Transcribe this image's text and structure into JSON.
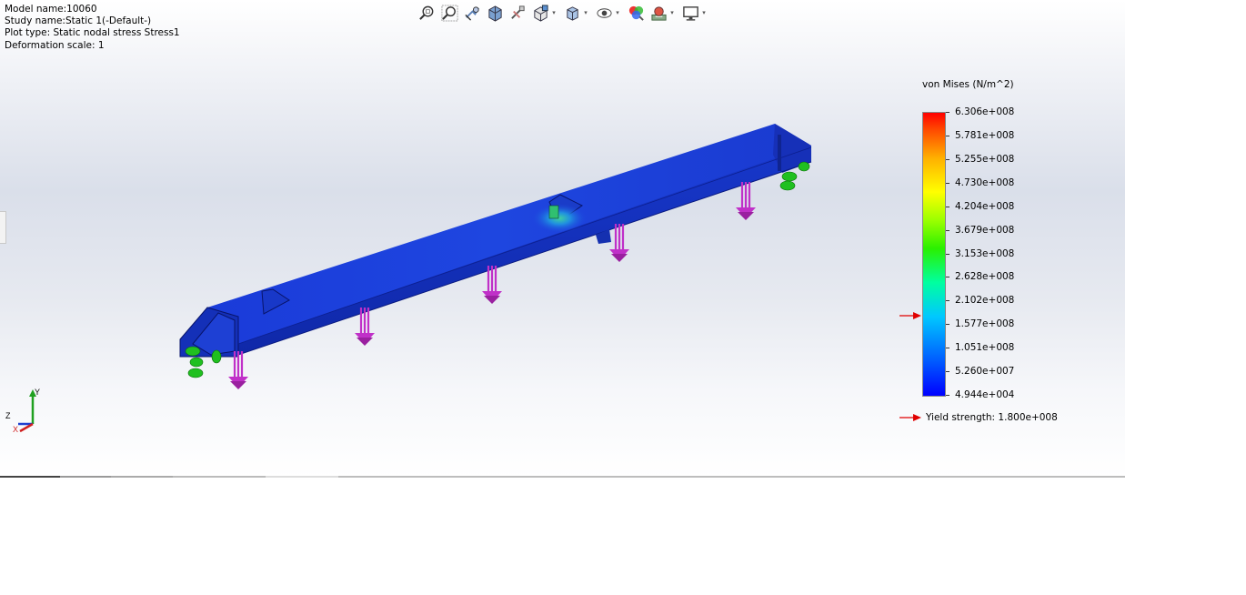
{
  "study_info": {
    "model_name": "Model name:10060",
    "study_name": "Study name:Static 1(-Default-)",
    "plot_type": "Plot type: Static nodal stress Stress1",
    "deformation_scale": "Deformation scale: 1"
  },
  "toolbar": {
    "icons": [
      "zoom-to-fit-icon",
      "zoom-to-area-icon",
      "previous-view-icon",
      "section-view-icon",
      "dynamic-annotation-icon",
      "view-orientation-icon",
      "display-style-icon",
      "hide-show-items-icon",
      "edit-appearance-icon",
      "apply-scene-icon",
      "view-settings-icon"
    ]
  },
  "legend": {
    "title": "von Mises (N/m^2)",
    "ticks": [
      "6.306e+008",
      "5.781e+008",
      "5.255e+008",
      "4.730e+008",
      "4.204e+008",
      "3.679e+008",
      "3.153e+008",
      "2.628e+008",
      "2.102e+008",
      "1.577e+008",
      "1.051e+008",
      "5.260e+007",
      "4.944e+004"
    ],
    "yield_label": "Yield strength: 1.800e+008",
    "colors": {
      "max": "#ff0000",
      "min": "#0000ff",
      "marker": "#e00000"
    }
  },
  "triad": {
    "x": "X",
    "y": "Y",
    "z": "Z"
  },
  "colors": {
    "beam": "#1030c8",
    "load_arrow": "#c030c8",
    "fixture": "#20c020"
  }
}
